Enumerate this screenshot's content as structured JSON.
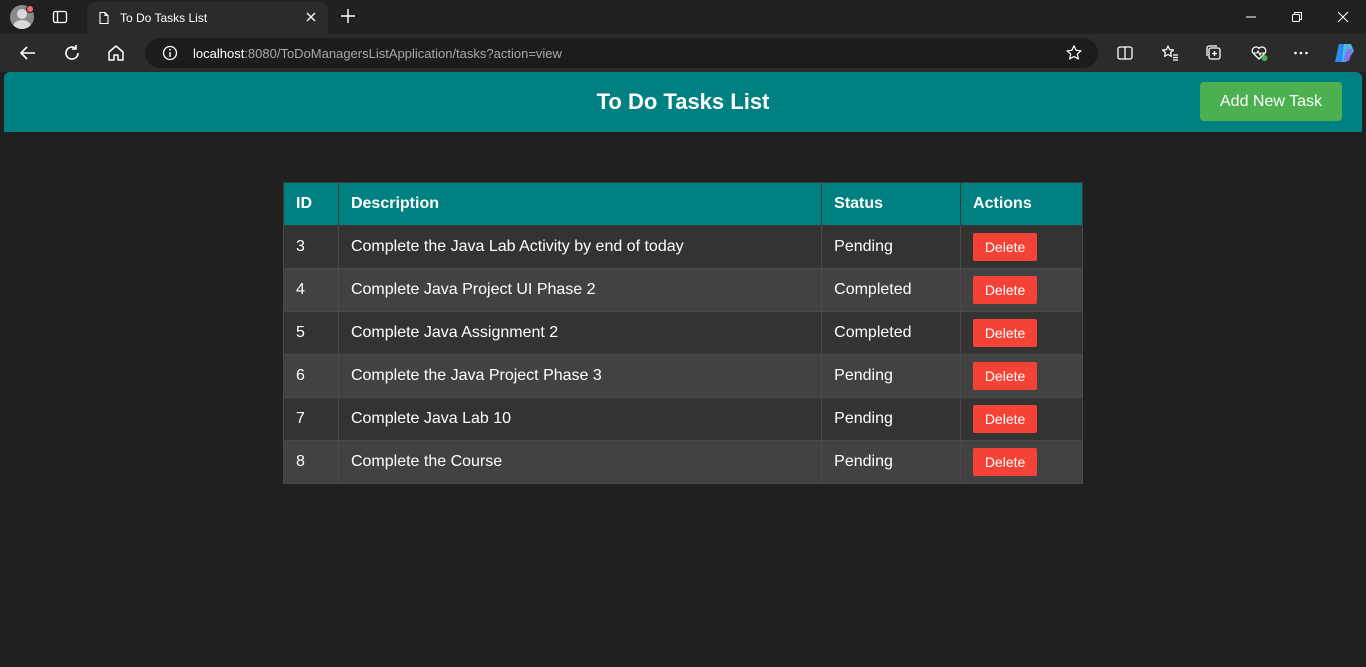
{
  "browser": {
    "tab_title": "To Do Tasks List",
    "url_host": "localhost",
    "url_rest": ":8080/ToDoManagersListApplication/tasks?action=view"
  },
  "page": {
    "title": "To Do Tasks List",
    "add_button": "Add New Task"
  },
  "table": {
    "headers": [
      "ID",
      "Description",
      "Status",
      "Actions"
    ],
    "rows": [
      {
        "id": "3",
        "description": "Complete the Java Lab Activity by end of today",
        "status": "Pending",
        "action": "Delete"
      },
      {
        "id": "4",
        "description": "Complete Java Project UI Phase 2",
        "status": "Completed",
        "action": "Delete"
      },
      {
        "id": "5",
        "description": "Complete Java Assignment 2",
        "status": "Completed",
        "action": "Delete"
      },
      {
        "id": "6",
        "description": "Complete the Java Project Phase 3",
        "status": "Pending",
        "action": "Delete"
      },
      {
        "id": "7",
        "description": "Complete Java Lab 10",
        "status": "Pending",
        "action": "Delete"
      },
      {
        "id": "8",
        "description": "Complete the Course",
        "status": "Pending",
        "action": "Delete"
      }
    ]
  },
  "colors": {
    "header_bg": "#008080",
    "add_button_bg": "#4caf50",
    "delete_button_bg": "#f44336",
    "page_bg": "#202020"
  }
}
